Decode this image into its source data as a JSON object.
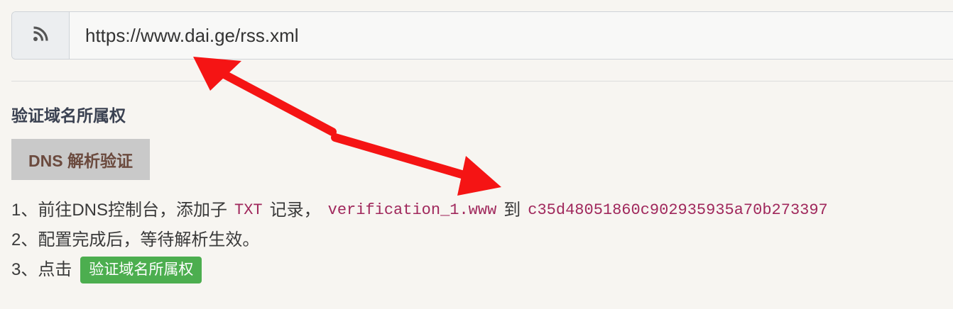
{
  "url_bar": {
    "icon": "rss-icon",
    "value": "https://www.dai.ge/rss.xml"
  },
  "section": {
    "title": "验证域名所属权",
    "method_label": "DNS 解析验证"
  },
  "steps": {
    "step1_prefix": "1、前往DNS控制台，添加子",
    "step1_type": "TXT",
    "step1_record": "记录，",
    "step1_host": "verification_1.www",
    "step1_to": "到",
    "step1_value": "c35d48051860c902935935a70b273397",
    "step2": "2、配置完成后，等待解析生效。",
    "step3_prefix": "3、点击",
    "step3_button": "验证域名所属权"
  },
  "annotation": {
    "arrow_color": "#f51414"
  },
  "colors": {
    "code": "#a0285c",
    "button": "#4cae4f",
    "method_tag_bg": "#c9c9c9",
    "page_bg": "#f7f5f1"
  }
}
